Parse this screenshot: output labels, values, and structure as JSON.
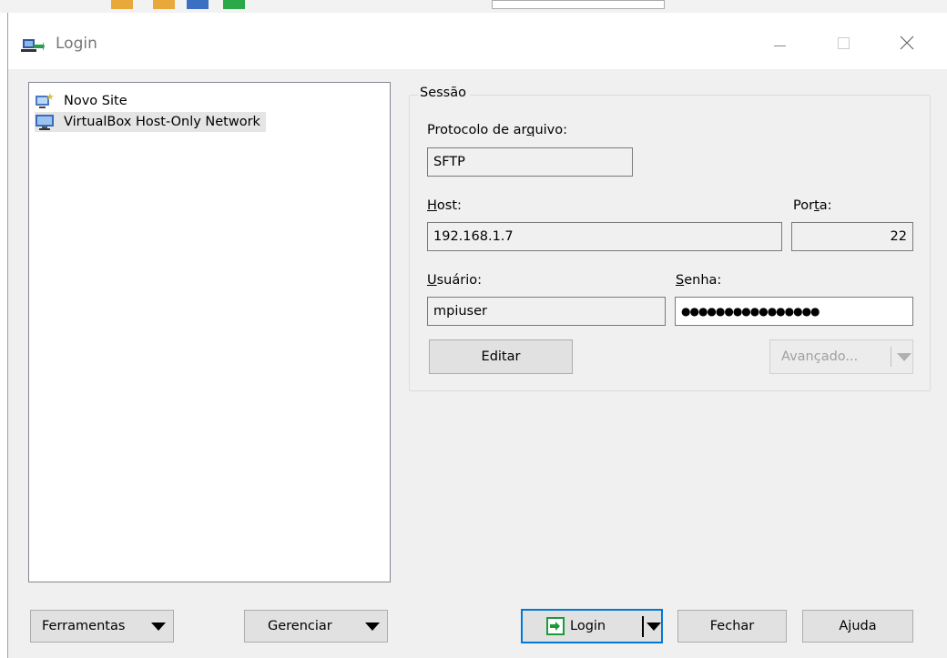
{
  "window": {
    "title": "Login"
  },
  "sites": [
    {
      "label": "Novo Site",
      "icon": "new-site-icon"
    },
    {
      "label": "VirtualBox Host-Only Network",
      "icon": "computer-icon"
    }
  ],
  "session": {
    "group_label": "Sessão",
    "protocol_label_pre": "Protocolo de ar",
    "protocol_label_acc": "q",
    "protocol_label_post": "uivo:",
    "protocol_value": "SFTP",
    "host_label_acc": "H",
    "host_label_post": "ost:",
    "host_value": "192.168.1.7",
    "port_label_pre": "Por",
    "port_label_acc": "t",
    "port_label_post": "a:",
    "port_value": "22",
    "user_label_acc": "U",
    "user_label_post": "suário:",
    "user_value": "mpiuser",
    "password_label_acc": "S",
    "password_label_post": "enha:",
    "password_value": "●●●●●●●●●●●●●●●●",
    "edit_button": "Editar",
    "advanced_button": "Avançado..."
  },
  "footer": {
    "tools_button": "Ferramentas",
    "manage_button": "Gerenciar",
    "login_button": "Login",
    "close_button": "Fechar",
    "help_button": "Ajuda"
  },
  "colors": {
    "focus": "#0078d7",
    "accent_green": "#1b9a3a"
  }
}
